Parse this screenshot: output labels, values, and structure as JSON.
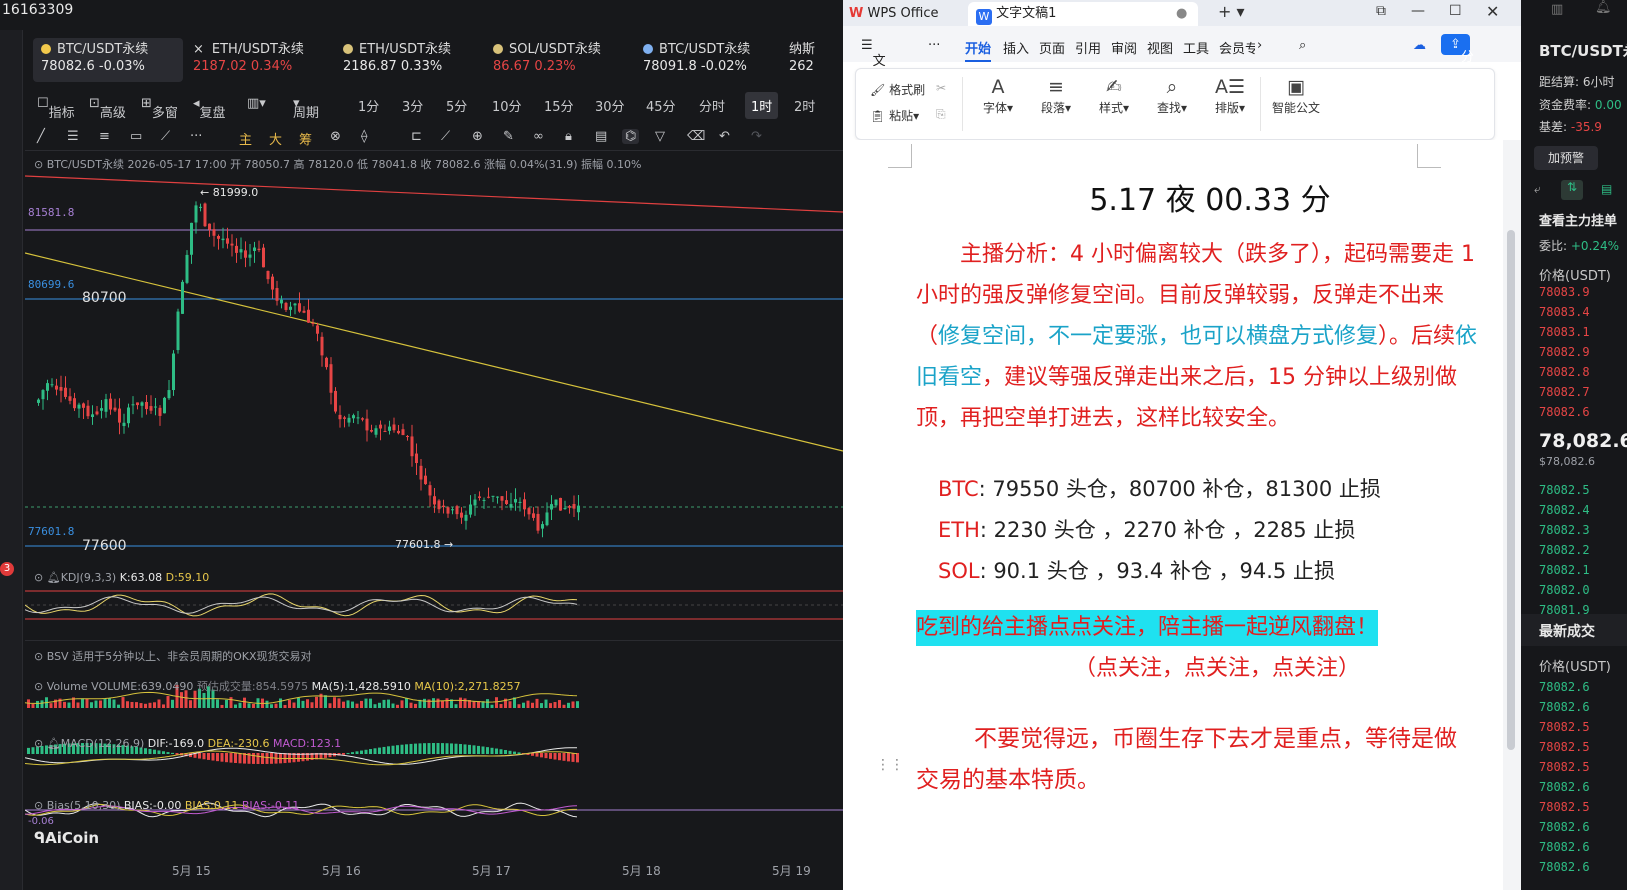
{
  "top_id": "16163309",
  "tickers": [
    {
      "name": "BTC/USDT永续",
      "price": "78082.6",
      "change": "-0.03%",
      "color": "#e7e7e7"
    },
    {
      "name": "ETH/USDT永续",
      "price": "2187.02",
      "change": "0.34%",
      "color": "#e64545"
    },
    {
      "name": "ETH/USDT永续",
      "price": "2186.87",
      "change": "0.33%",
      "color": "#e7e7e7"
    },
    {
      "name": "SOL/USDT永续",
      "price": "86.67",
      "change": "0.23%",
      "color": "#e64545"
    },
    {
      "name": "BTC/USDT永续",
      "price": "78091.8",
      "change": "-0.02%",
      "color": "#e7e7e7"
    },
    {
      "name": "纳斯",
      "price": "262",
      "change": "",
      "color": "#e7e7e7"
    }
  ],
  "toolbar": {
    "indicator": "指标",
    "advanced": "高级",
    "multi": "多窗",
    "replay": "复盘",
    "period": "周期",
    "periods": [
      "1分",
      "3分",
      "5分",
      "10分",
      "15分",
      "30分",
      "45分",
      "分时",
      "1时",
      "2时"
    ],
    "active_period": "1时"
  },
  "drawtools": [
    "主",
    "大",
    "筹"
  ],
  "chart": {
    "header": "BTC/USDT永续 2026-05-17 17:00 开 78050.7 高 78120.0 低 78041.8 收 78082.6 涨幅 0.04%(31.9) 振幅 0.10%",
    "price_81581": "81581.8",
    "price_80699": "80699.6",
    "label_80700": "80700",
    "high_label": "← 81999.0",
    "price_77601": "77601.8",
    "label_77600": "77600",
    "low_label": "77601.8 →",
    "x_labels": [
      "5月 15",
      "5月 16",
      "5月 17",
      "5月 18",
      "5月 19"
    ],
    "watermark": "AiCoin",
    "badge": "3"
  },
  "indicators": {
    "kdj": "KDJ(9,3,3)",
    "kdj_k": "K:63.08",
    "kdj_d": "D:59.10",
    "bsv": "BSV  适用于5分钟以上、非会员周期的OKX现货交易对",
    "vol": "Volume  VOLUME:639.0490",
    "vol_est": "预估成交量:854.5975",
    "vol_ma5": "MA(5):1,428.5910",
    "vol_ma10": "MA(10):2,271.8257",
    "macd": "MACD(12,26,9)",
    "macd_dif": "DIF:-169.0",
    "macd_dea": "DEA:-230.6",
    "macd_m": "MACD:123.1",
    "bias": "Bias(5,10,30)",
    "bias1": "BIAS:-0.00",
    "bias2": "BIAS:0.11",
    "bias3": "BIAS:-0.11",
    "bias_val": "-0.06"
  },
  "wps": {
    "app": "WPS Office",
    "doc_tab": "文字文稿1",
    "menu": [
      "文件",
      "···",
      "开始",
      "插入",
      "页面",
      "引用",
      "审阅",
      "视图",
      "工具",
      "会员专"
    ],
    "share": "分享",
    "ribbon": {
      "format_brush": "格式刷",
      "paste": "粘贴",
      "font": "字体",
      "paragraph": "段落",
      "style": "样式",
      "find": "查找",
      "layout": "排版",
      "ai": "智能公文"
    }
  },
  "doc": {
    "title": "5.17  夜 00.33 分",
    "p1_a": "主播分析：4 小时偏离较大（跌多了），起码需要走 1 小时的强反弹修复空间。目前反弹较弱，反弹走不出来（",
    "p1_b": "修复空间，不一定要涨，也可以横盘方式修复",
    "p1_c": "）。后续",
    "p1_d": "依旧看空",
    "p1_e": "，建议等强反弹走出来之后，15 分钟以上级别做顶，再把空单打进去，这样比较安全。",
    "btc_k": "BTC",
    "btc_v": ": 79550 头仓，80700 补仓，81300 止损",
    "eth_k": "ETH",
    "eth_v": ": 2230 头仓 ，2270 补仓 ，2285 止损",
    "sol_k": "SOL",
    "sol_v": ": 90.1 头仓 ，93.4 补仓  ，94.5 止损",
    "highlight": "吃到的给主播点点关注，陪主播一起逆风翻盘！",
    "follow": "（点关注，点关注，点关注）",
    "end": "不要觉得远，币圈生存下去才是重点，等待是做交易的基本特质。"
  },
  "book": {
    "title": "BTC/USDT永",
    "settle": "距结算: 6小时",
    "funding_label": "资金费率:",
    "funding": "0.00",
    "basis_label": "基差:",
    "basis": "-35.9",
    "alert": "加预警",
    "tab": "查看主力挂单",
    "ratio_label": "委比:",
    "ratio": "+0.24%",
    "price_hdr": "价格(USDT)",
    "asks": [
      "78083.9",
      "78083.4",
      "78083.1",
      "78082.9",
      "78082.8",
      "78082.7",
      "78082.6"
    ],
    "last": "78,082.6",
    "last_sub": "$78,082.6",
    "bids": [
      "78082.5",
      "78082.4",
      "78082.3",
      "78082.2",
      "78082.1",
      "78082.0",
      "78081.9"
    ],
    "trades_title": "最新成交",
    "trades": [
      "78082.6",
      "78082.6",
      "78082.5",
      "78082.5",
      "78082.5",
      "78082.6",
      "78082.5",
      "78082.6",
      "78082.6",
      "78082.6"
    ],
    "trade_colors": [
      "g",
      "g",
      "r",
      "r",
      "r",
      "g",
      "r",
      "g",
      "g",
      "g"
    ]
  }
}
